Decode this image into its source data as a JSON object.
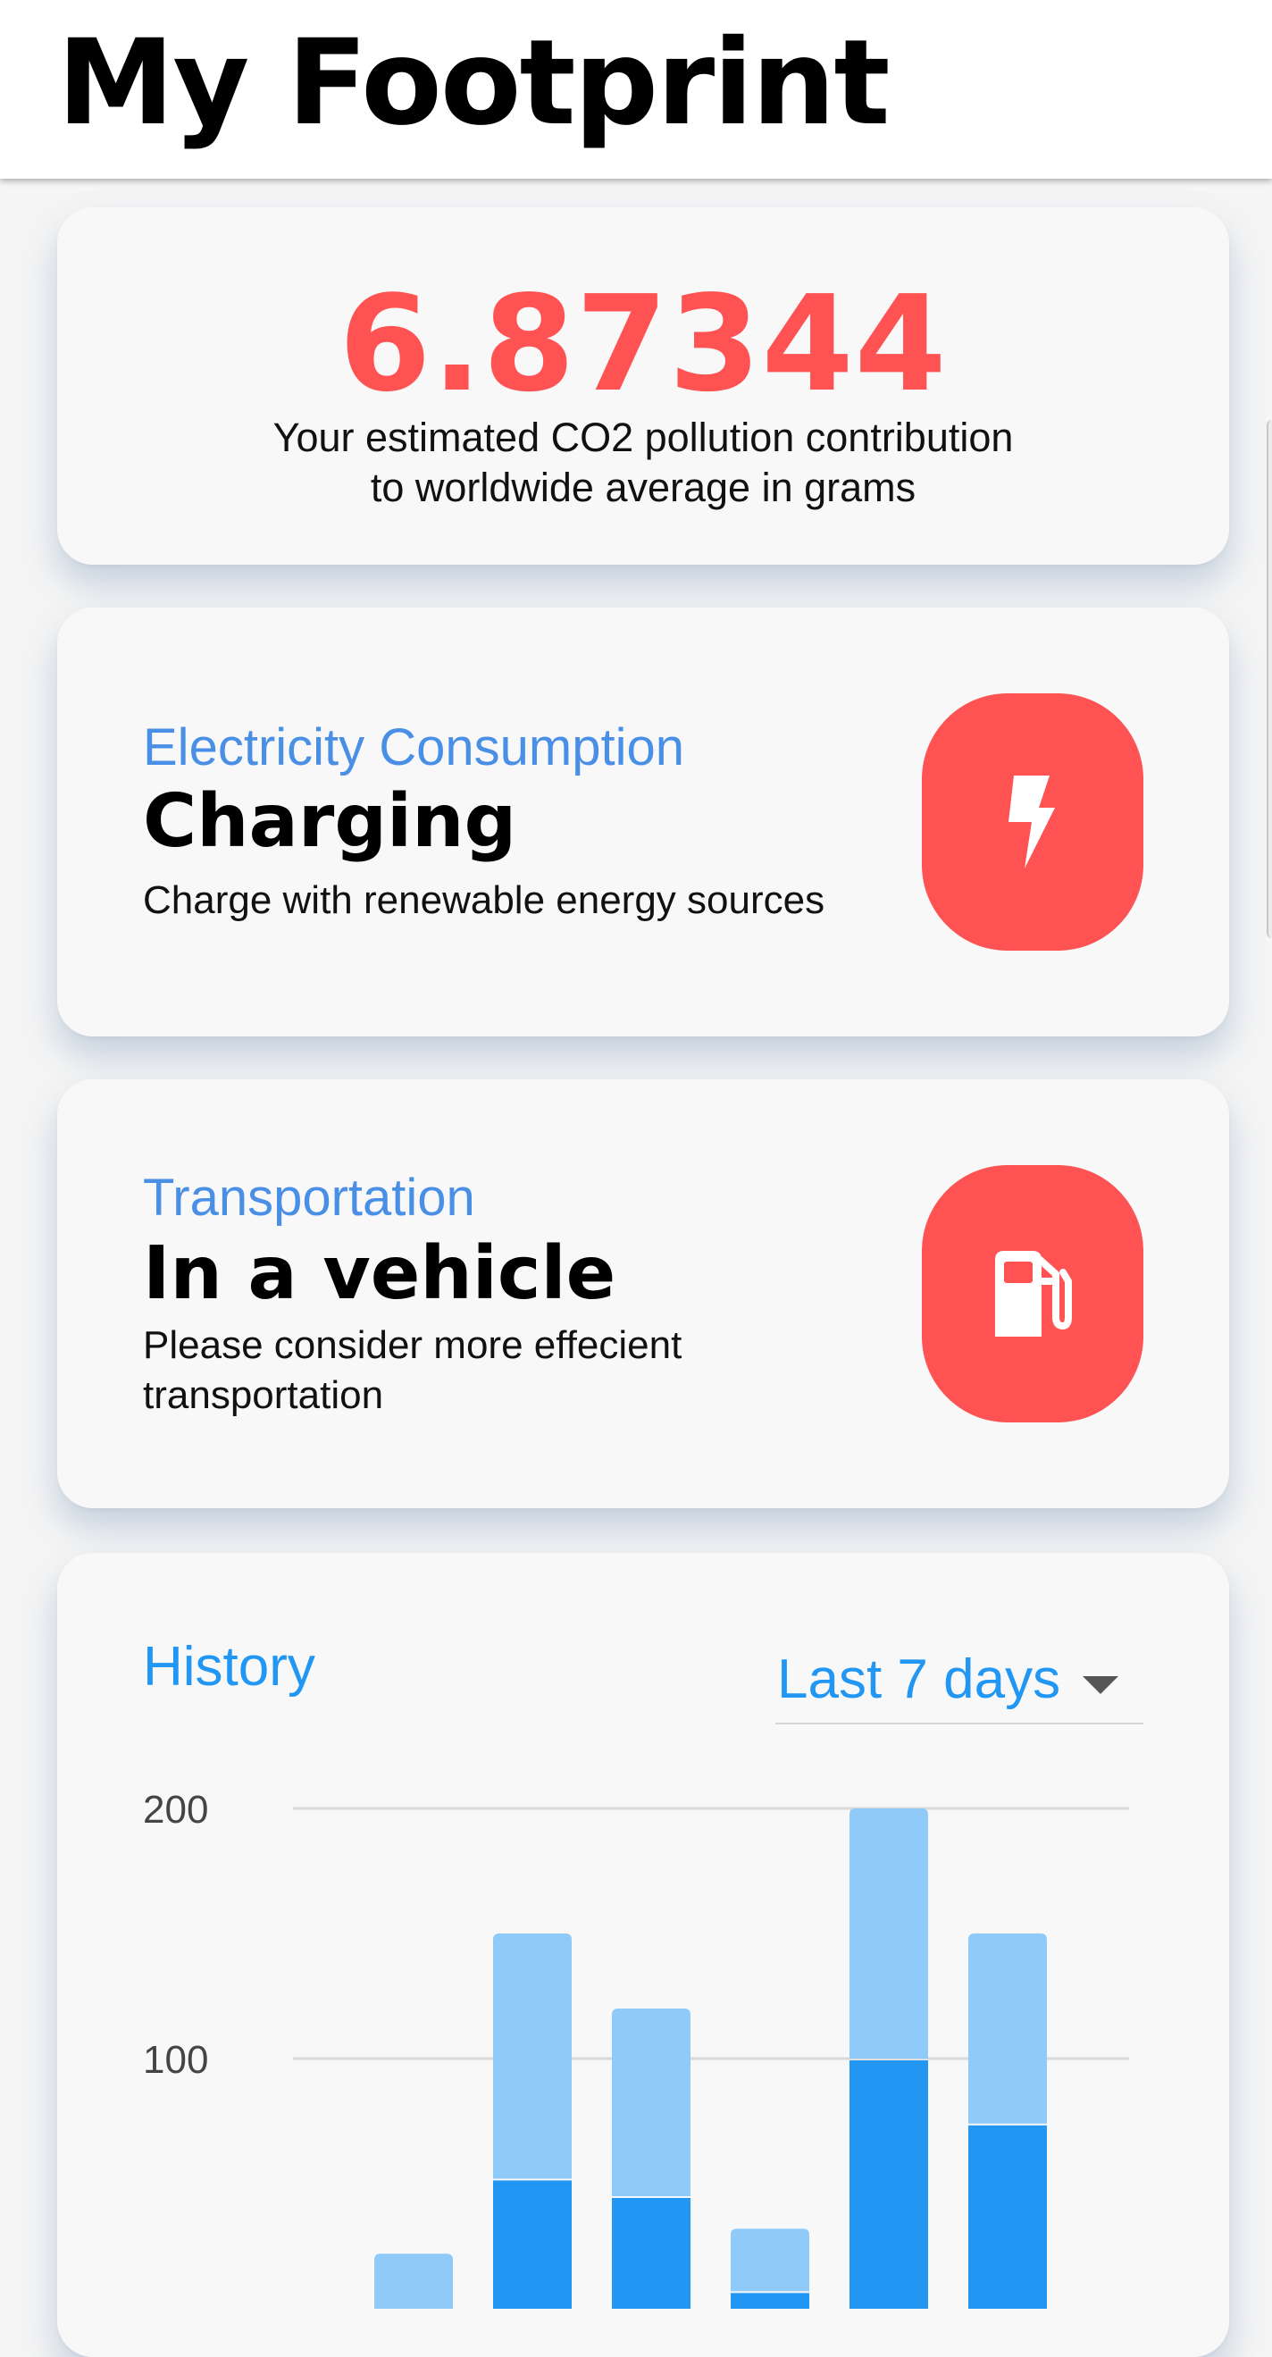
{
  "app_bar": {
    "title": "My Footprint"
  },
  "footprint": {
    "value": "6.87344",
    "caption_line1": "Your estimated CO2 pollution contribution",
    "caption_line2": "to worldwide average in grams",
    "value_color": "#ff5252"
  },
  "electricity": {
    "category": "Electricity Consumption",
    "title": "Charging",
    "description": "Charge with renewable energy sources",
    "icon": "bolt-icon"
  },
  "transportation": {
    "category": "Transportation",
    "title": "In a vehicle",
    "description": "Please consider more effecient transportation",
    "icon": "gas-station-icon"
  },
  "history": {
    "title": "History",
    "range_selected": "Last 7 days"
  },
  "colors": {
    "accent": "#2196f3",
    "category_text": "#4a8fe6",
    "icon_tile": "#ff5252",
    "bar_light": "#90caf9",
    "bar_dark": "#2196f3"
  },
  "chart_data": {
    "type": "bar",
    "stacked": true,
    "y_ticks": [
      "100",
      "200"
    ],
    "ylim": [
      0,
      200
    ],
    "grid": true,
    "series": [
      {
        "values": [
          0,
          52,
          45,
          7,
          100,
          74
        ]
      },
      {
        "values": [
          22,
          98,
          75,
          25,
          100,
          76
        ]
      }
    ]
  }
}
